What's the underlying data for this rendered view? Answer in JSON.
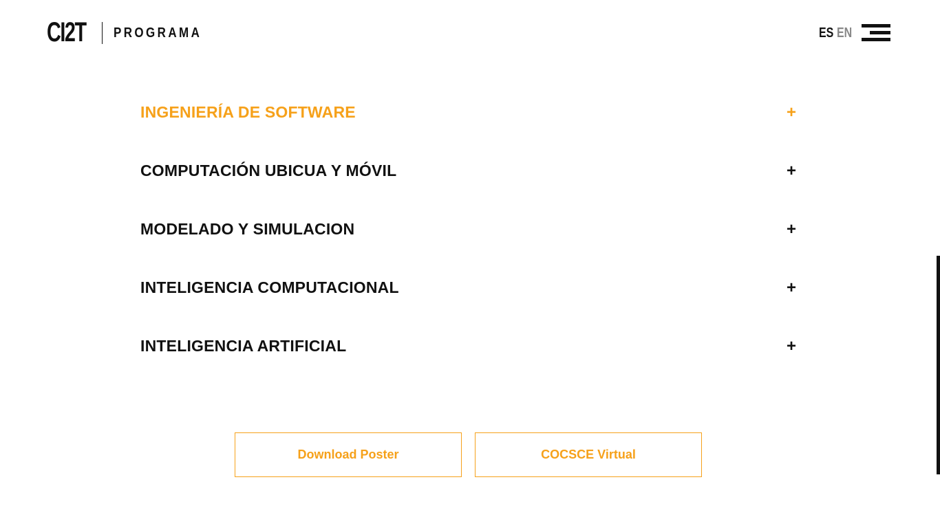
{
  "header": {
    "logo": "CI2T",
    "section_title": "PROGRAMA",
    "lang_es": "ES",
    "lang_en": "EN",
    "menu_icon": "hamburger-menu-icon"
  },
  "accordion": {
    "items": [
      {
        "title": "INGENIERÍA DE SOFTWARE",
        "icon": "+",
        "active": true
      },
      {
        "title": "COMPUTACIÓN UBICUA Y MÓVIL",
        "icon": "+",
        "active": false
      },
      {
        "title": "MODELADO Y SIMULACION",
        "icon": "+",
        "active": false
      },
      {
        "title": "INTELIGENCIA COMPUTACIONAL",
        "icon": "+",
        "active": false
      },
      {
        "title": "INTELIGENCIA ARTIFICIAL",
        "icon": "+",
        "active": false
      }
    ]
  },
  "buttons": {
    "download_poster": "Download Poster",
    "cocsce_virtual": "COCSCE Virtual"
  },
  "colors": {
    "accent": "#f6a11a",
    "text": "#111111",
    "muted": "#888888",
    "background": "#ffffff"
  }
}
